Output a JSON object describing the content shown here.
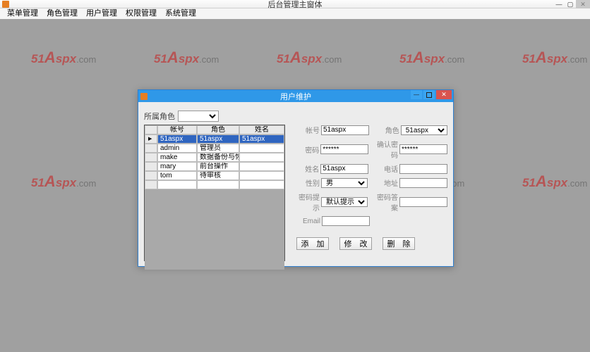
{
  "main": {
    "title": "后台管理主窗体",
    "menus": [
      "菜单管理",
      "角色管理",
      "用户管理",
      "权限管理",
      "系统管理"
    ]
  },
  "watermark": {
    "prefix": "51",
    "big": "A",
    "rest": "spx",
    "suffix": ".com"
  },
  "dialog": {
    "title": "用户维护",
    "filter_label": "所属角色",
    "filter_value": "",
    "grid": {
      "headers": [
        "帐号",
        "角色",
        "姓名"
      ],
      "rows": [
        {
          "acct": "51aspx",
          "role": "51aspx",
          "name": "51aspx"
        },
        {
          "acct": "admin",
          "role": "管理员",
          "name": ""
        },
        {
          "acct": "make",
          "role": "数据备份与恢复",
          "name": ""
        },
        {
          "acct": "mary",
          "role": "前台操作",
          "name": ""
        },
        {
          "acct": "tom",
          "role": "待审核",
          "name": ""
        }
      ]
    },
    "form": {
      "labels": {
        "acct": "帐号",
        "role": "角色",
        "pwd": "密码",
        "confirm": "确认密码",
        "name": "姓名",
        "tel": "电话",
        "sex": "性别",
        "addr": "地址",
        "hint": "密码提示",
        "answer": "密码答案",
        "email": "Email"
      },
      "values": {
        "acct": "51aspx",
        "role": "51aspx",
        "pwd": "******",
        "confirm": "******",
        "name": "51aspx",
        "tel": "",
        "sex": "男",
        "addr": "",
        "hint": "默认提示",
        "answer": "",
        "email": ""
      },
      "buttons": {
        "add": "添 加",
        "edit": "修 改",
        "del": "删 除"
      }
    }
  }
}
